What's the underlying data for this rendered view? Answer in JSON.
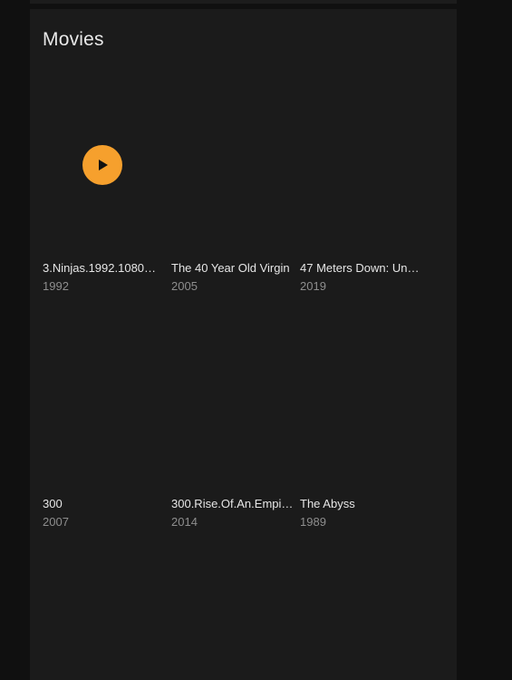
{
  "section": {
    "title": "Movies"
  },
  "movies": [
    {
      "title": "3.Ninjas.1992.1080…",
      "year": "1992"
    },
    {
      "title": "The 40 Year Old Virgin",
      "year": "2005"
    },
    {
      "title": "47 Meters Down: Un…",
      "year": "2019"
    },
    {
      "title": "300",
      "year": "2007"
    },
    {
      "title": "300.Rise.Of.An.Empi…",
      "year": "2014"
    },
    {
      "title": "The Abyss",
      "year": "1989"
    }
  ],
  "colors": {
    "background": "#101010",
    "panel": "#1b1b1b",
    "accent": "#f6a02d",
    "title_text": "#e6e6e6",
    "secondary_text": "#8e8e8e"
  },
  "icons": {
    "play": "play-icon"
  }
}
